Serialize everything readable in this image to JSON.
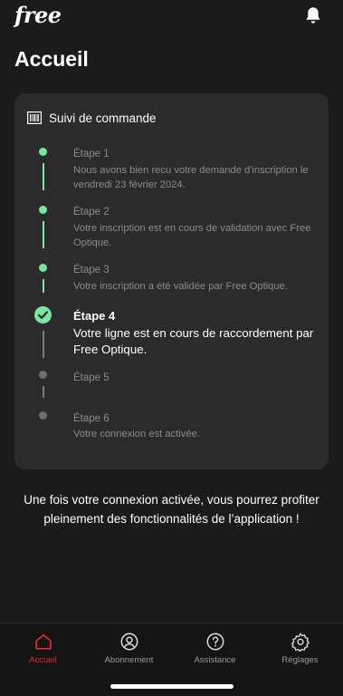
{
  "app": {
    "logo_text": "free"
  },
  "header": {
    "title": "Accueil"
  },
  "order": {
    "title": "Suivi de commande",
    "steps": [
      {
        "label": "Étape 1",
        "status": "done",
        "description": "Nous avons bien recu votre demande d'inscription le vendredi 23 février 2024."
      },
      {
        "label": "Étape 2",
        "status": "done",
        "description": "Votre inscription est en cours de validation avec Free Optique."
      },
      {
        "label": "Étape 3",
        "status": "done",
        "description": "Votre inscription a été validée par Free Optique."
      },
      {
        "label": "Étape 4",
        "status": "current",
        "description": "Votre ligne est en cours de raccordement par Free Optique."
      },
      {
        "label": "Étape 5",
        "status": "pending",
        "description": ""
      },
      {
        "label": "Étape 6",
        "status": "pending",
        "description": "Votre connexion est activée."
      }
    ]
  },
  "info_text": "Une fois votre connexion activée, vous pourrez profiter pleinement des fonctionnalités de l’application !",
  "tabbar": {
    "items": [
      {
        "label": "Accueil",
        "icon": "home-icon",
        "active": true
      },
      {
        "label": "Abonnement",
        "icon": "user-circle-icon",
        "active": false
      },
      {
        "label": "Assistance",
        "icon": "help-circle-icon",
        "active": false
      },
      {
        "label": "Réglages",
        "icon": "gear-icon",
        "active": false
      }
    ]
  },
  "colors": {
    "background": "#1b1b1b",
    "card": "#2b2b2b",
    "done_green": "#7be5a0",
    "active_tab_red": "#e62a2a",
    "muted_text": "#8c8c8c"
  }
}
